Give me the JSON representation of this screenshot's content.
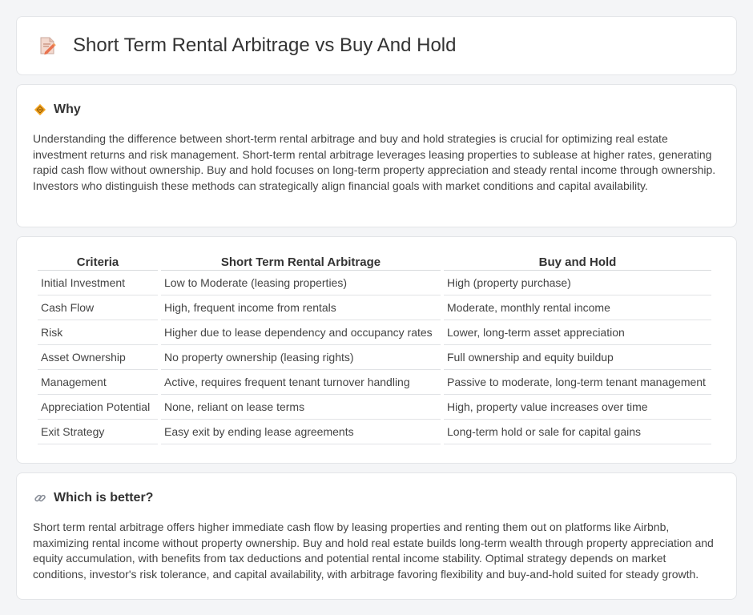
{
  "header": {
    "title": "Short Term Rental Arbitrage vs Buy And Hold",
    "icon": "document-edit-icon"
  },
  "why": {
    "icon": "diamond-sign-icon",
    "heading": "Why",
    "text": "Understanding the difference between short-term rental arbitrage and buy and hold strategies is crucial for optimizing real estate investment returns and risk management. Short-term rental arbitrage leverages leasing properties to sublease at higher rates, generating rapid cash flow without ownership. Buy and hold focuses on long-term property appreciation and steady rental income through ownership. Investors who distinguish these methods can strategically align financial goals with market conditions and capital availability."
  },
  "table": {
    "headers": [
      "Criteria",
      "Short Term Rental Arbitrage",
      "Buy and Hold"
    ],
    "rows": [
      [
        "Initial Investment",
        "Low to Moderate (leasing properties)",
        "High (property purchase)"
      ],
      [
        "Cash Flow",
        "High, frequent income from rentals",
        "Moderate, monthly rental income"
      ],
      [
        "Risk",
        "Higher due to lease dependency and occupancy rates",
        "Lower, long-term asset appreciation"
      ],
      [
        "Asset Ownership",
        "No property ownership (leasing rights)",
        "Full ownership and equity buildup"
      ],
      [
        "Management",
        "Active, requires frequent tenant turnover handling",
        "Passive to moderate, long-term tenant management"
      ],
      [
        "Appreciation Potential",
        "None, reliant on lease terms",
        "High, property value increases over time"
      ],
      [
        "Exit Strategy",
        "Easy exit by ending lease agreements",
        "Long-term hold or sale for capital gains"
      ]
    ]
  },
  "better": {
    "icon": "link-icon",
    "heading": "Which is better?",
    "text": "Short term rental arbitrage offers higher immediate cash flow by leasing properties and renting them out on platforms like Airbnb, maximizing rental income without property ownership. Buy and hold real estate builds long-term wealth through property appreciation and equity accumulation, with benefits from tax deductions and potential rental income stability. Optimal strategy depends on market conditions, investor's risk tolerance, and capital availability, with arbitrage favoring flexibility and buy-and-hold suited for steady growth."
  }
}
